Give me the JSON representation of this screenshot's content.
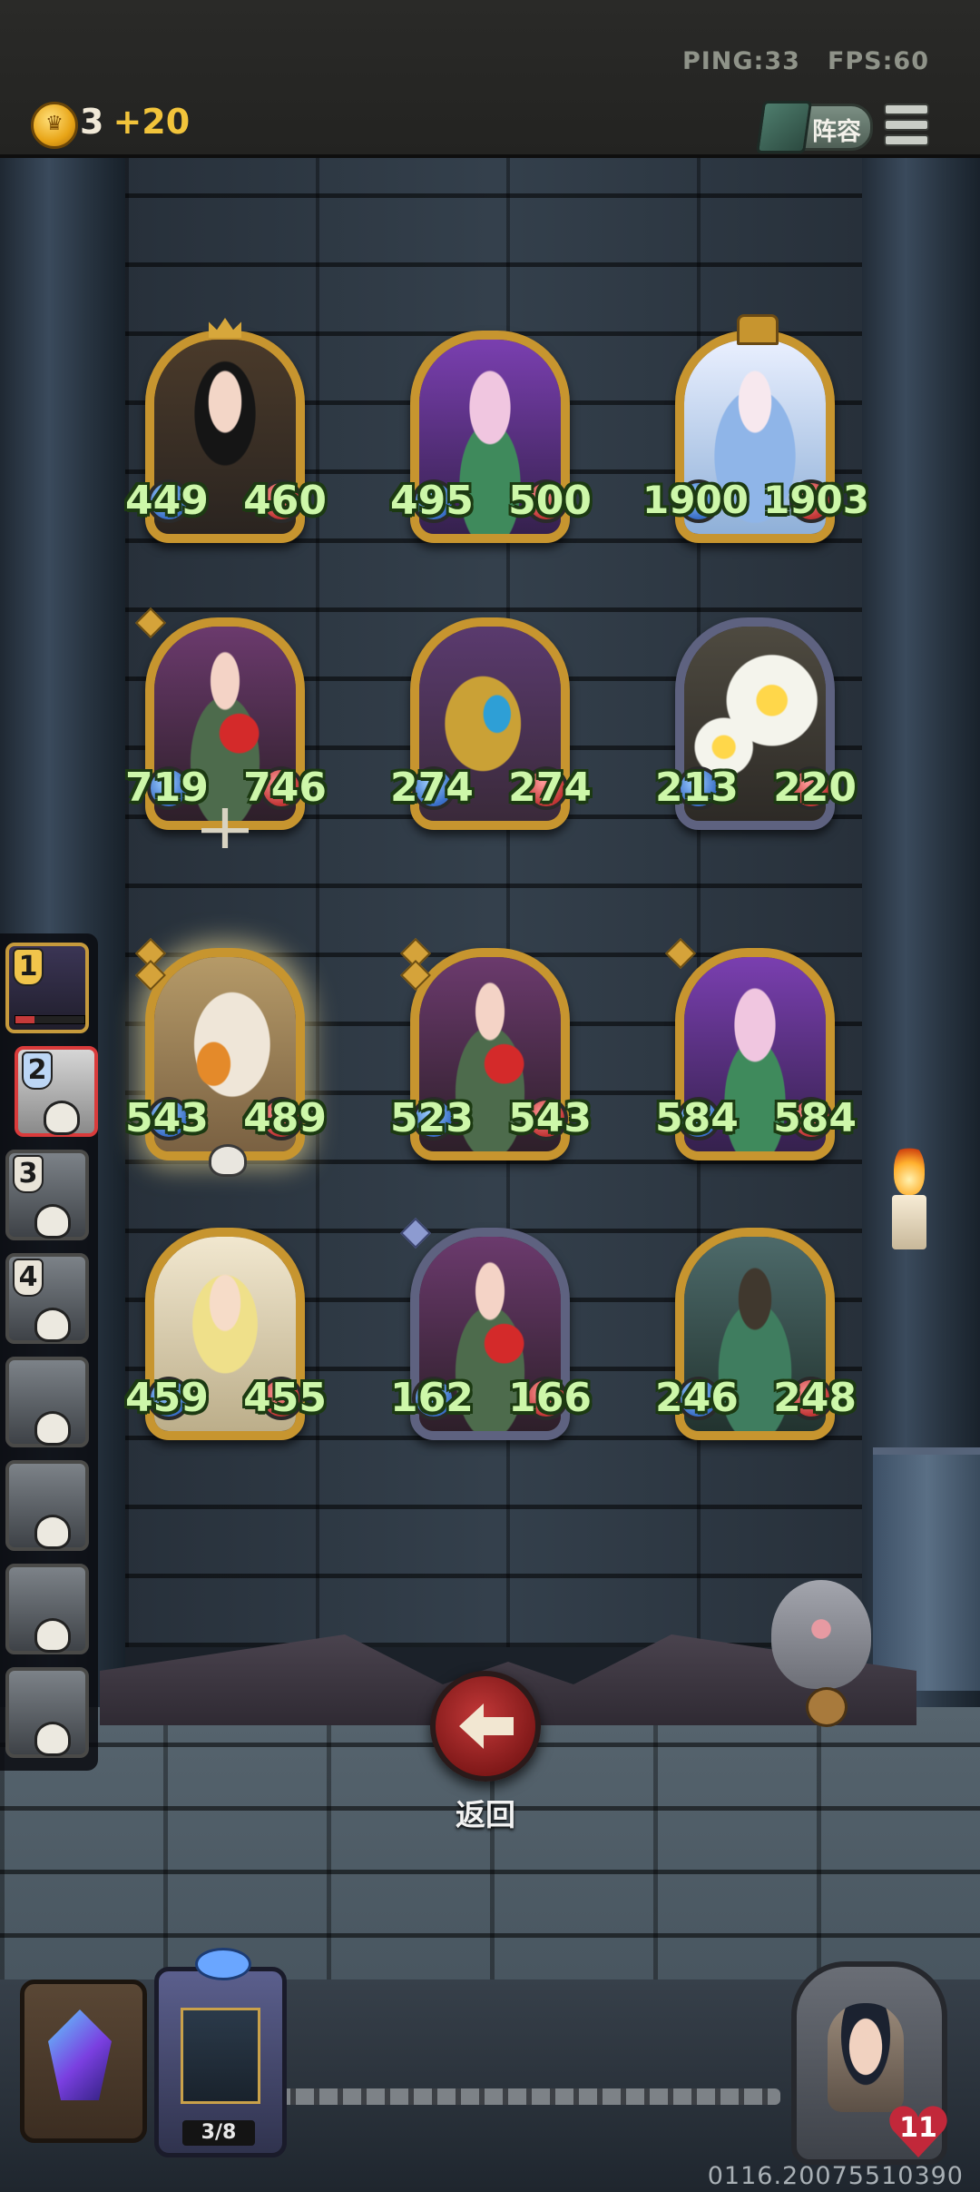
{
  "header": {
    "ping": "PING:33",
    "fps": "FPS:60",
    "gold": "3",
    "gold_income": "+20",
    "lineup_label": "阵容"
  },
  "board": [
    {
      "name": "dark-haired-fairy",
      "attack": "449",
      "health": "460",
      "frame": "gold"
    },
    {
      "name": "purple-flower-fairy",
      "attack": "495",
      "health": "500",
      "frame": "gold"
    },
    {
      "name": "ice-princess",
      "attack": "1900",
      "health": "1903",
      "frame": "gold"
    },
    {
      "name": "red-berry-elf",
      "attack": "719",
      "health": "746",
      "frame": "gold"
    },
    {
      "name": "golden-gauntlet",
      "attack": "274",
      "health": "274",
      "frame": "gold"
    },
    {
      "name": "singing-flowers",
      "attack": "213",
      "health": "220",
      "frame": "silver"
    },
    {
      "name": "pelican",
      "attack": "543",
      "health": "489",
      "frame": "gold"
    },
    {
      "name": "red-berry-elf-2",
      "attack": "523",
      "health": "543",
      "frame": "gold"
    },
    {
      "name": "purple-flower-fairy-2",
      "attack": "584",
      "health": "584",
      "frame": "gold"
    },
    {
      "name": "blonde-elf",
      "attack": "459",
      "health": "455",
      "frame": "gold"
    },
    {
      "name": "red-berry-elf-3",
      "attack": "162",
      "health": "166",
      "frame": "silver"
    },
    {
      "name": "antler-ent",
      "attack": "246",
      "health": "248",
      "frame": "gold"
    }
  ],
  "roster": [
    {
      "rank": "1",
      "state": "current"
    },
    {
      "rank": "2",
      "state": "selected"
    },
    {
      "rank": "3",
      "state": "eliminated"
    },
    {
      "rank": "4",
      "state": "eliminated"
    },
    {
      "rank": "",
      "state": "eliminated"
    },
    {
      "rank": "",
      "state": "eliminated"
    },
    {
      "rank": "",
      "state": "eliminated"
    },
    {
      "rank": "",
      "state": "eliminated"
    }
  ],
  "back_label": "返回",
  "items": {
    "pack_count": "3/8"
  },
  "player": {
    "lives": "11"
  },
  "uid": "0116.20075510390"
}
